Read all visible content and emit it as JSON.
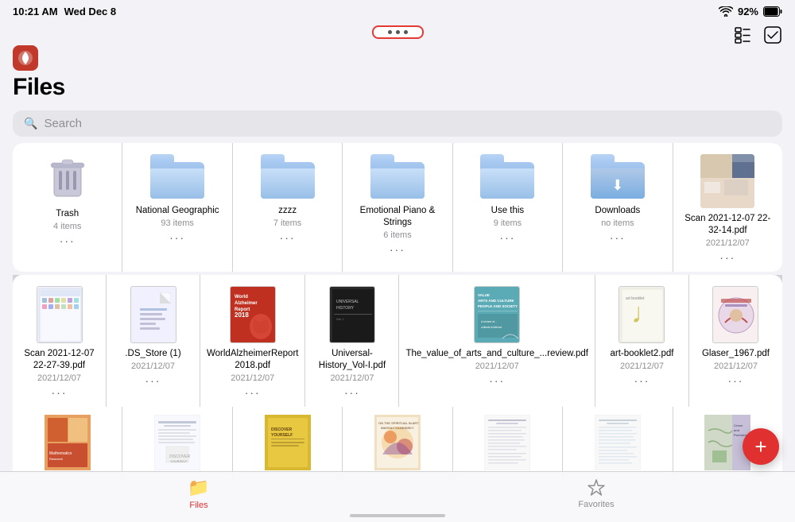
{
  "statusBar": {
    "time": "10:21 AM",
    "date": "Wed Dec 8",
    "battery": "92%",
    "wifi": "wifi"
  },
  "header": {
    "title": "Files",
    "searchPlaceholder": "Search"
  },
  "toolbar": {
    "dots": "···",
    "gridViewLabel": "grid-view",
    "checkLabel": "check"
  },
  "tabs": [
    {
      "id": "files",
      "label": "Files",
      "active": true
    },
    {
      "id": "favorites",
      "label": "Favorites",
      "active": false
    }
  ],
  "fab": "+",
  "row1": [
    {
      "id": "trash",
      "type": "trash",
      "name": "Trash",
      "meta": "4 items"
    },
    {
      "id": "natgeo",
      "type": "folder",
      "name": "National Geographic",
      "meta": "93 items"
    },
    {
      "id": "zzzz",
      "type": "folder",
      "name": "zzzz",
      "meta": "7 items"
    },
    {
      "id": "emotional",
      "type": "folder",
      "name": "Emotional Piano & Strings",
      "meta": "6 items"
    },
    {
      "id": "usethis",
      "type": "folder",
      "name": "Use this",
      "meta": "9 items"
    },
    {
      "id": "downloads",
      "type": "folder-download",
      "name": "Downloads",
      "meta": "no items"
    },
    {
      "id": "scan1",
      "type": "photo",
      "name": "Scan 2021-12-07 22-32-14.pdf",
      "meta": "2021/12/07",
      "bgColor": "#c8b8a0"
    }
  ],
  "row2": [
    {
      "id": "scan2",
      "type": "pdf-screenshot",
      "name": "Scan 2021-12-07 22-27-39.pdf",
      "meta": "2021/12/07",
      "color": "#e8f0fe"
    },
    {
      "id": "dsstore",
      "type": "doc",
      "name": ".DS_Store (1)",
      "meta": "2021/12/07",
      "color": "#e8f0fe"
    },
    {
      "id": "alzheimer",
      "type": "pdf-red",
      "name": "WorldAlzheimerReport 2018.pdf",
      "meta": "2021/12/07"
    },
    {
      "id": "universal",
      "type": "pdf-dark",
      "name": "Universal-History_Vol-I.pdf",
      "meta": "2021/12/07"
    },
    {
      "id": "arts",
      "type": "pdf-teal",
      "name": "The_value_of_arts_and_culture_...review.pdf",
      "meta": "2021/12/07"
    },
    {
      "id": "artbooklet",
      "type": "pdf-yellow",
      "name": "art-booklet2.pdf",
      "meta": "2021/12/07"
    },
    {
      "id": "glaser",
      "type": "pdf-decorative",
      "name": "Glaser_1967.pdf",
      "meta": "2021/12/07"
    }
  ],
  "row3": [
    {
      "id": "r3-1",
      "type": "pdf-colorful",
      "color": "#e8a0a0"
    },
    {
      "id": "r3-2",
      "type": "pdf-white",
      "color": "#f0f0f0"
    },
    {
      "id": "r3-3",
      "type": "pdf-yellow2",
      "color": "#e8d070"
    },
    {
      "id": "r3-4",
      "type": "pdf-orange",
      "color": "#f0c060"
    },
    {
      "id": "r3-5",
      "type": "pdf-light",
      "color": "#f8f8f8"
    },
    {
      "id": "r3-6",
      "type": "pdf-white2",
      "color": "#f0f0f0"
    },
    {
      "id": "r3-7",
      "type": "pdf-green",
      "color": "#70b080"
    }
  ]
}
